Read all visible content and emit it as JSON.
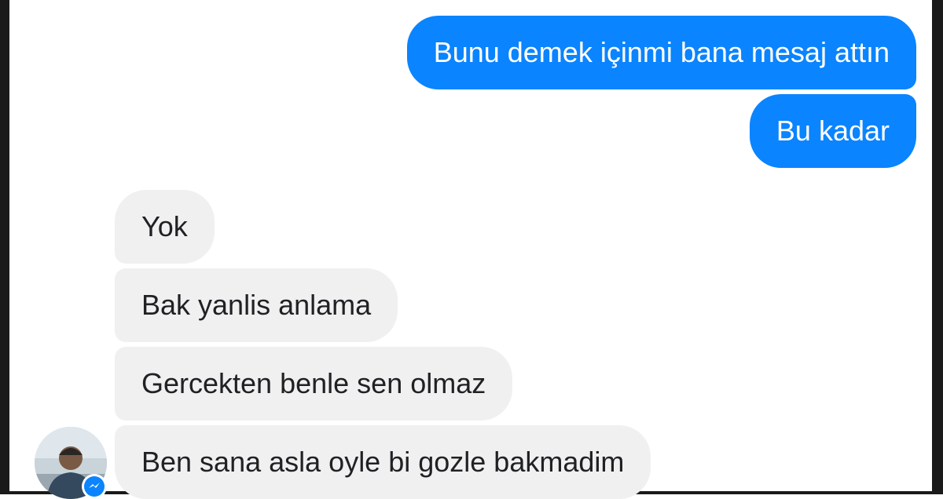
{
  "conversation": {
    "sent": [
      "Bunu demek içinmi bana mesaj attın",
      "Bu kadar"
    ],
    "received": [
      "Yok",
      "Bak yanlis anlama",
      "Gercekten benle sen olmaz",
      "Ben sana asla oyle bi gozle bakmadim"
    ]
  },
  "contact": {
    "avatar_icon": "profile-photo",
    "status_icon": "messenger-icon"
  },
  "colors": {
    "sent_bubble": "#0a84ff",
    "received_bubble": "#f0f0f0",
    "background": "#ffffff"
  }
}
